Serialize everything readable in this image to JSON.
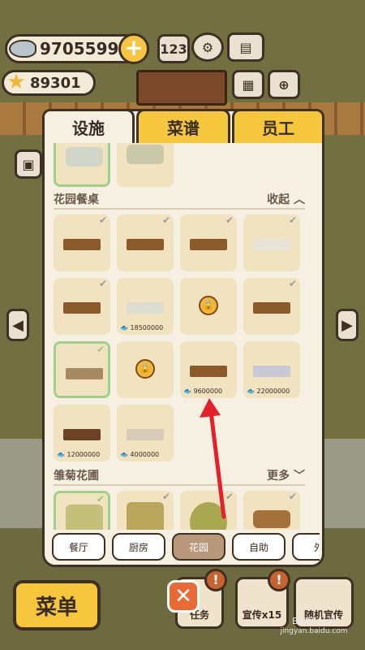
{
  "hud": {
    "fish_count": "9705599",
    "star_count": "89301",
    "plus_label": "+"
  },
  "tabs": [
    {
      "label": "设施",
      "active": true
    },
    {
      "label": "菜谱",
      "active": false
    },
    {
      "label": "员工",
      "active": false
    }
  ],
  "sections": [
    {
      "title": "花园餐桌",
      "toggle": "收起"
    },
    {
      "title": "雏菊花圃",
      "toggle": "更多"
    }
  ],
  "cards_row3": [
    {
      "price": "9600000"
    },
    {
      "price": "22000000"
    }
  ],
  "cards_row2": [
    {
      "price": "18500000"
    }
  ],
  "cards_row4": [
    {
      "price": "12000000"
    },
    {
      "price": "4000000"
    }
  ],
  "categories": [
    "餐厅",
    "厨房",
    "花园",
    "自助",
    "外"
  ],
  "bottom": {
    "menu_label": "菜单",
    "close_label": "✕",
    "task_label": "任务",
    "promo_label": "宣传x15",
    "random_promo_label": "随机宣传",
    "alert": "!"
  },
  "watermark": {
    "line1": "Bai度 经验",
    "line2": "jingyan.baidu.com"
  },
  "colors": {
    "accent_yellow": "#f6c73d",
    "panel_bg": "#f6f0e3",
    "arrow_red": "#e5202a",
    "selected_border": "#9fcf8a"
  }
}
